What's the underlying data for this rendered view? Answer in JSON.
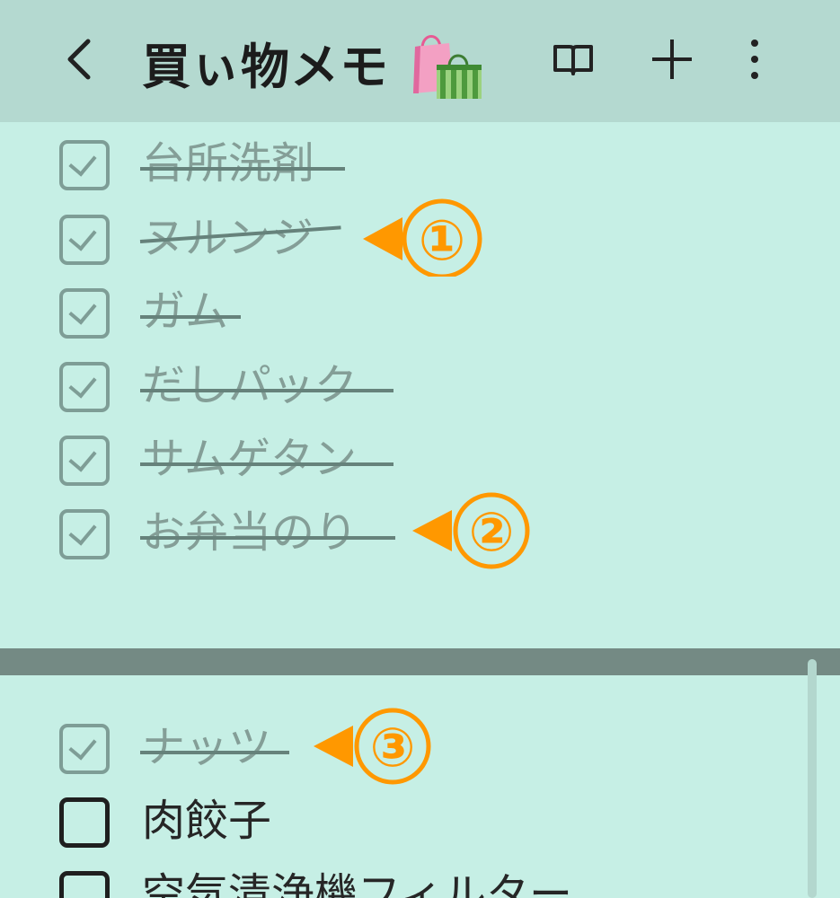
{
  "header": {
    "title": "買ぃ物メモ",
    "back_icon": "chevron-left-icon",
    "bag_icon": "shopping-bags-icon",
    "reader_icon": "book-open-icon",
    "add_icon": "plus-icon",
    "more_icon": "more-vertical-icon"
  },
  "checked_items": [
    {
      "label": "台所洗剤",
      "checked": true
    },
    {
      "label": "ヌルンジ",
      "checked": true
    },
    {
      "label": "ガム",
      "checked": true
    },
    {
      "label": "だしパック",
      "checked": true
    },
    {
      "label": "サムゲタン",
      "checked": true
    },
    {
      "label": "お弁当のり",
      "checked": true
    }
  ],
  "list_items": [
    {
      "label": "ナッツ",
      "checked": true
    },
    {
      "label": "肉餃子",
      "checked": false
    },
    {
      "label": "空気清浄機フィルター",
      "checked": false
    }
  ],
  "annotations": [
    {
      "marker": "①"
    },
    {
      "marker": "②"
    },
    {
      "marker": "③"
    }
  ],
  "colors": {
    "header_bg": "#b4d9d0",
    "list_bg": "#c6efe5",
    "divider": "#748a84",
    "callout": "#ff9800",
    "checked_gray": "#849e97"
  }
}
